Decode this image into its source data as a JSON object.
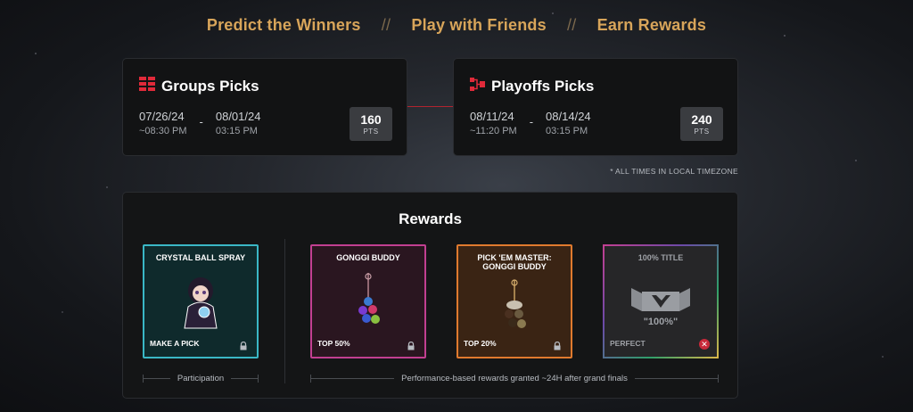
{
  "tagline": {
    "items": [
      "Predict the Winners",
      "Play with Friends",
      "Earn Rewards"
    ],
    "separator": "//"
  },
  "groups": {
    "title": "Groups Picks",
    "icon": "grid-icon",
    "start_date": "07/26/24",
    "start_time": "~08:30 PM",
    "dash": "-",
    "end_date": "08/01/24",
    "end_time": "03:15 PM",
    "points": "160",
    "points_unit": "PTS"
  },
  "playoffs": {
    "title": "Playoffs Picks",
    "icon": "bracket-icon",
    "start_date": "08/11/24",
    "start_time": "~11:20 PM",
    "dash": "-",
    "end_date": "08/14/24",
    "end_time": "03:15 PM",
    "points": "240",
    "points_unit": "PTS"
  },
  "timezone_note": "* ALL TIMES IN LOCAL TIMEZONE",
  "rewards": {
    "title": "Rewards",
    "items": [
      {
        "label": "CRYSTAL BALL SPRAY",
        "footer": "MAKE A PICK",
        "status": "locked",
        "border": "#3ab7c6"
      },
      {
        "label": "GONGGI BUDDY",
        "footer": "TOP 50%",
        "status": "locked",
        "border": "#c23f91"
      },
      {
        "label": "PICK 'EM MASTER: GONGGI BUDDY",
        "footer": "TOP 20%",
        "status": "locked",
        "border": "#e07a2e"
      },
      {
        "label": "100% TITLE",
        "title_text": "\"100%\"",
        "footer": "PERFECT",
        "status": "failed",
        "border": "#6b4aa8"
      }
    ],
    "participation_note": "Participation",
    "performance_note": "Performance-based rewards granted ~24H after grand finals"
  },
  "colors": {
    "accent_gold": "#d8a55a",
    "accent_red": "#e02a3a"
  }
}
